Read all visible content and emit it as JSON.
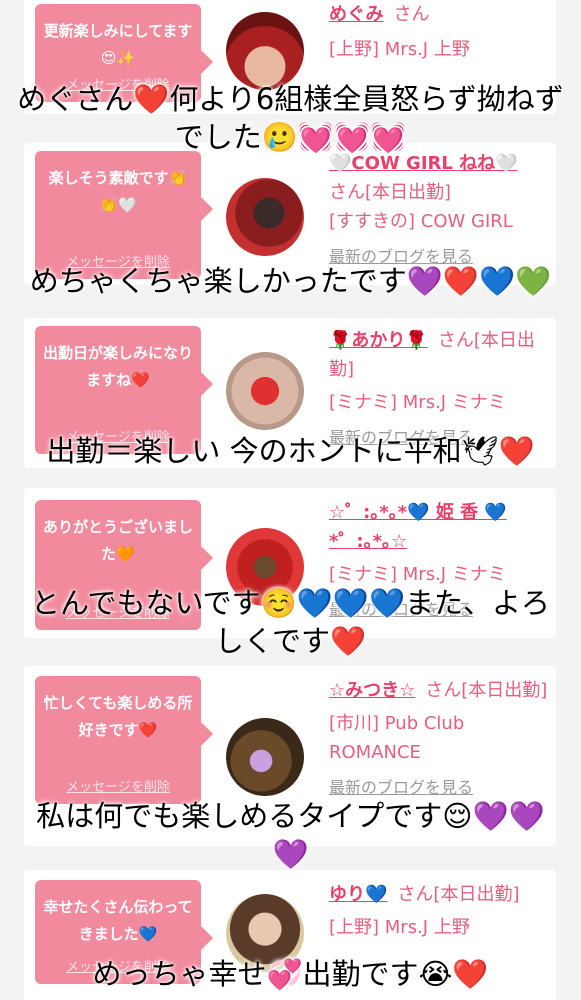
{
  "delete_label": "メッセージを削除",
  "blog_label": "最新のブログを見る",
  "san": "さん",
  "cards": [
    {
      "message": "更新楽しみにしてます😍✨",
      "name": "めぐみ",
      "status": "",
      "shop": "[上野] Mrs.J 上野",
      "overlay": "めぐさん❤️何より6組様全員怒らず拗ねずでした🥲💓💓💓"
    },
    {
      "message": "楽しそう素敵です👏👏🤍",
      "name": "🤍COW GIRL ねね🤍",
      "status": "[本日出勤]",
      "shop": "[すすきの] COW GIRL",
      "overlay": "めちゃくちゃ楽しかったです💜❤️💙💚"
    },
    {
      "message": "出勤日が楽しみになりますね❤️",
      "name": "🌹あかり🌹",
      "status": "[本日出勤]",
      "shop": "[ミナミ] Mrs.J ミナミ",
      "overlay": "出勤＝楽しい 今のホントに平和🕊❤️"
    },
    {
      "message": "ありがとうございました🧡",
      "name": "☆゜:｡*｡*💙 姫 香 💙*゜:｡*｡☆",
      "status": "",
      "shop": "[ミナミ] Mrs.J ミナミ",
      "overlay": "とんでもないです☺️💙💙💙また、よろしくです❤️"
    },
    {
      "message": "忙しくても楽しめる所好きです❤️",
      "name": "☆みつき☆",
      "status": "[本日出勤]",
      "shop": "[市川] Pub Club ROMANCE",
      "overlay": "私は何でも楽しめるタイプです😌💜💜💜"
    },
    {
      "message": "幸せたくさん伝わってきました💙",
      "name": "ゆり💙",
      "status": "[本日出勤]",
      "shop": "[上野] Mrs.J 上野",
      "overlay": "めっちゃ幸せ💞出勤です😭❤️"
    }
  ],
  "colors": {
    "bubble": "#f28a9e",
    "name": "#e5416b",
    "text": "#e5607e"
  }
}
